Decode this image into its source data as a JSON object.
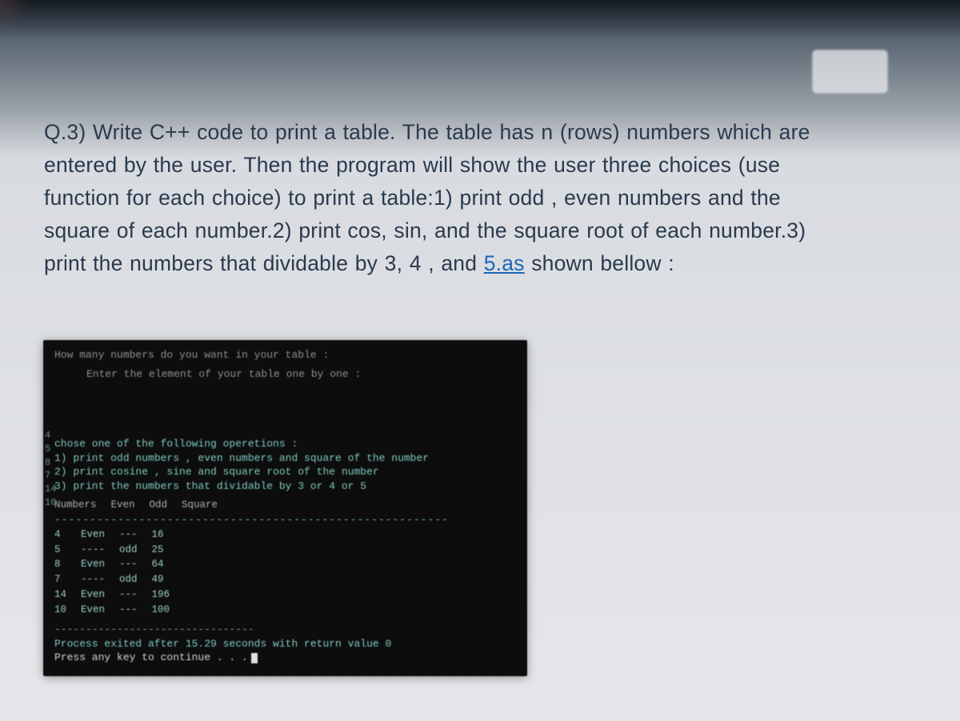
{
  "question": {
    "prefix": "Q.3) ",
    "line1": "Write C++ code to print a table. The table has n (rows) numbers which are",
    "line2": "entered by the user. Then the program will show the user three choices (use",
    "line3": "function for each choice) to print a table:1) print odd , even numbers and the",
    "line4": "square of each number.2) print cos, sin, and the square root of each number.3)",
    "line5_a": "print the numbers that dividable by 3, 4 , and ",
    "line5_link": "5.as",
    "line5_b": " shown bellow :"
  },
  "terminal": {
    "prompt1": "How many numbers do you want in your table :",
    "prompt2": "Enter the element of your table one by one :",
    "side_numbers": [
      "4",
      "5",
      "8",
      "7",
      "14",
      "10"
    ],
    "menu_title": "chose one of the following operetions :",
    "menu1": "1) print odd numbers , even numbers and square of the number",
    "menu2": "2) print cosine , sine and square root of the number",
    "menu3": "3) print the numbers that dividable by 3 or 4 or 5",
    "headers": [
      "Numbers",
      "Even",
      "Odd",
      "Square"
    ],
    "divider": "--------------------------------------------------------",
    "rows": [
      {
        "n": "4",
        "even": "Even",
        "odd": "---",
        "sq": "16"
      },
      {
        "n": "5",
        "even": "----",
        "odd": "odd",
        "sq": "25"
      },
      {
        "n": "8",
        "even": "Even",
        "odd": "---",
        "sq": "64"
      },
      {
        "n": "7",
        "even": "----",
        "odd": "odd",
        "sq": "49"
      },
      {
        "n": "14",
        "even": "Even",
        "odd": "---",
        "sq": "196"
      },
      {
        "n": "10",
        "even": "Even",
        "odd": "---",
        "sq": "100"
      }
    ],
    "dashline": "--------------------------------",
    "exit_line": "Process exited after 15.29 seconds with return value 0",
    "press_line": "Press any key to continue . . ."
  }
}
